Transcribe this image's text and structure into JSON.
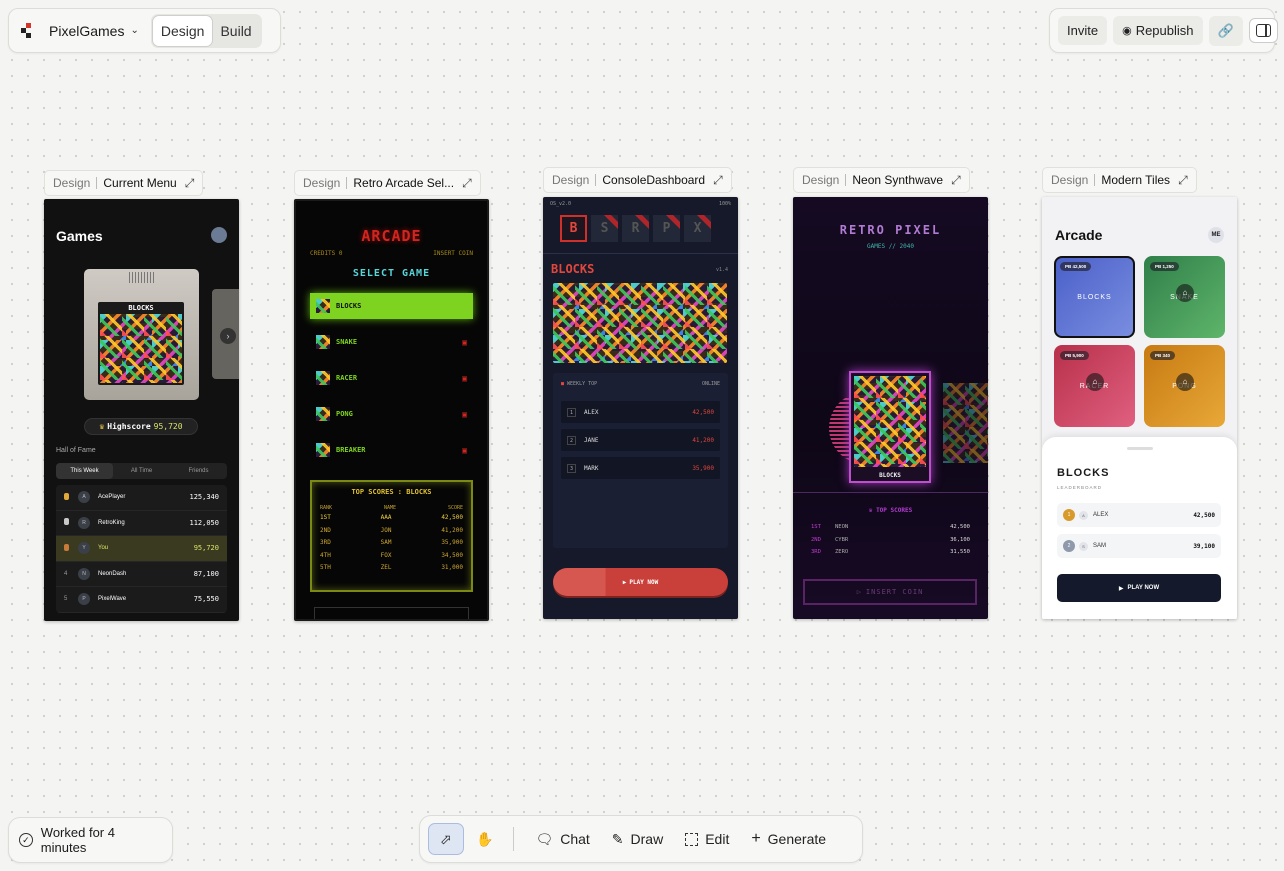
{
  "app": {
    "project": "PixelGames",
    "mode_tabs": [
      "Design",
      "Build"
    ],
    "active_mode": "Design"
  },
  "toolbar": {
    "invite": "Invite",
    "republish": "Republish"
  },
  "frames": [
    {
      "label": "Design",
      "name": "Current Menu"
    },
    {
      "label": "Design",
      "name": "Retro Arcade Sel..."
    },
    {
      "label": "Design",
      "name": "ConsoleDashboard"
    },
    {
      "label": "Design",
      "name": "Neon Synthwave"
    },
    {
      "label": "Design",
      "name": "Modern Tiles"
    }
  ],
  "f1": {
    "title": "Games",
    "cart": "BLOCKS",
    "highscore_label": "Highscore",
    "highscore": "95,720",
    "hof": "Hall of Fame",
    "tabs": [
      "This Week",
      "All Time",
      "Friends"
    ],
    "rows": [
      {
        "rank": "",
        "init": "A",
        "name": "AcePlayer",
        "score": "125,340"
      },
      {
        "rank": "",
        "init": "R",
        "name": "RetroKing",
        "score": "112,050"
      },
      {
        "rank": "",
        "init": "Y",
        "name": "You",
        "score": "95,720"
      },
      {
        "rank": "4",
        "init": "N",
        "name": "NeonDash",
        "score": "87,100"
      },
      {
        "rank": "5",
        "init": "P",
        "name": "PixelWave",
        "score": "75,550"
      }
    ]
  },
  "f2": {
    "title": "ARCADE",
    "credits": "CREDITS 0",
    "insert": "INSERT COIN",
    "select": "SELECT GAME",
    "games": [
      "BLOCKS",
      "SNAKE",
      "RACER",
      "PONG",
      "BREAKER"
    ],
    "scores_title": "TOP SCORES : BLOCKS",
    "cols": [
      "RANK",
      "NAME",
      "SCORE"
    ],
    "scores": [
      [
        "1ST",
        "AAA",
        "42,500"
      ],
      [
        "2ND",
        "JON",
        "41,200"
      ],
      [
        "3RD",
        "SAM",
        "35,900"
      ],
      [
        "4TH",
        "FOX",
        "34,500"
      ],
      [
        "5TH",
        "ZEL",
        "31,000"
      ]
    ]
  },
  "f3": {
    "os": "OS_v2.0",
    "battery": "100%",
    "letters": [
      "B",
      "S",
      "R",
      "P",
      "X"
    ],
    "title": "BLOCKS",
    "ver": "v1.4",
    "weekly": "WEEKLY TOP",
    "online": "ONLINE",
    "rows": [
      {
        "n": "1",
        "name": "ALEX",
        "score": "42,500"
      },
      {
        "n": "2",
        "name": "JANE",
        "score": "41,200"
      },
      {
        "n": "3",
        "name": "MARK",
        "score": "35,900"
      }
    ],
    "play": "PLAY NOW"
  },
  "f4": {
    "title": "RETRO PIXEL",
    "sub": "GAMES // 2040",
    "cart": "BLOCKS",
    "top": "TOP SCORES",
    "rows": [
      {
        "r": "1ST",
        "name": "NEON",
        "score": "42,500"
      },
      {
        "r": "2ND",
        "name": "CYBR",
        "score": "36,100"
      },
      {
        "r": "3RD",
        "name": "ZERO",
        "score": "31,550"
      }
    ],
    "coin": "INSERT COIN"
  },
  "f5": {
    "title": "Arcade",
    "me": "ME",
    "tiles": [
      {
        "pb": "PB 42,500",
        "name": "BLOCKS"
      },
      {
        "pb": "PB 1,250",
        "name": "SNAKE"
      },
      {
        "pb": "PB 5,900",
        "name": "RACER"
      },
      {
        "pb": "PB 340",
        "name": "PONG"
      }
    ],
    "sheet_title": "BLOCKS",
    "sheet_sub": "LEADERBOARD",
    "rows": [
      {
        "n": "1",
        "i": "A",
        "name": "ALEX",
        "score": "42,500"
      },
      {
        "n": "2",
        "i": "S",
        "name": "SAM",
        "score": "39,100"
      }
    ],
    "play": "PLAY NOW"
  },
  "status": "Worked for 4 minutes",
  "bottom": {
    "chat": "Chat",
    "draw": "Draw",
    "edit": "Edit",
    "generate": "Generate"
  }
}
